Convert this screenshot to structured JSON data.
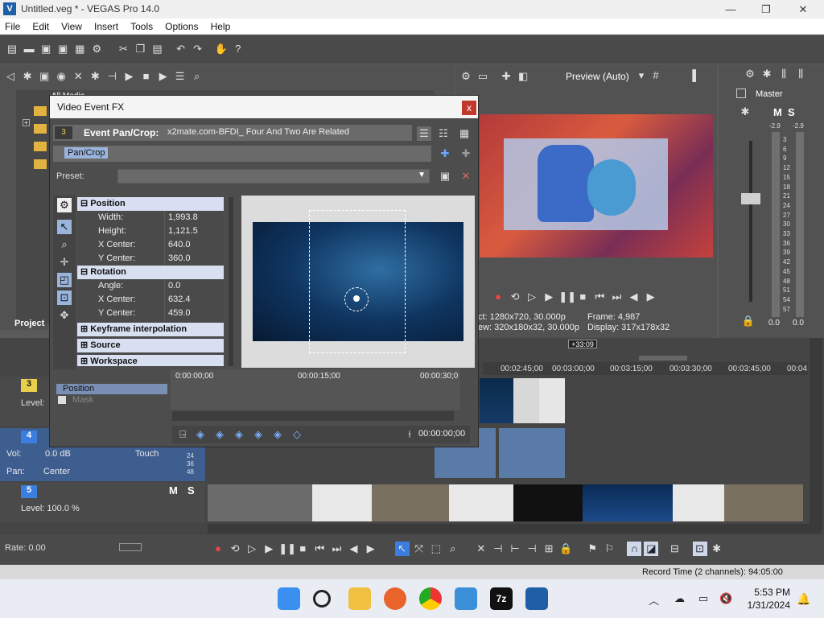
{
  "window": {
    "title": "Untitled.veg * - VEGAS Pro 14.0",
    "logo": "V",
    "minimize": "—",
    "maximize": "❐",
    "close": "✕"
  },
  "menu": [
    "File",
    "Edit",
    "View",
    "Insert",
    "Tools",
    "Options",
    "Help"
  ],
  "explorer": {
    "all_media": "All Media",
    "project_tab": "Project"
  },
  "dialog": {
    "title": "Video Event FX",
    "close": "x",
    "header_label": "Event Pan/Crop:",
    "header_value": "x2mate.com-BFDI_ Four And Two Are Related",
    "track_num": "3",
    "chain_item": "Pan/Crop",
    "preset_label": "Preset:",
    "sections": {
      "position": "Position",
      "rotation": "Rotation",
      "keyframe": "Keyframe interpolation",
      "source": "Source",
      "workspace": "Workspace"
    },
    "position": [
      {
        "k": "Width:",
        "v": "1,993.8"
      },
      {
        "k": "Height:",
        "v": "1,121.5"
      },
      {
        "k": "X Center:",
        "v": "640.0"
      },
      {
        "k": "Y Center:",
        "v": "360.0"
      }
    ],
    "rotation": [
      {
        "k": "Angle:",
        "v": "0.0"
      },
      {
        "k": "X Center:",
        "v": "632.4"
      },
      {
        "k": "Y Center:",
        "v": "459.0"
      }
    ],
    "kf_rows": {
      "position": "Position",
      "mask": "Mask"
    },
    "kf_ruler": [
      "0:00:00;00",
      "00:00:15;00",
      "00:00:30;0"
    ],
    "kf_time": "00:00:00;00"
  },
  "preview": {
    "label": "Preview (Auto)",
    "project_line": "ct:  1280x720, 30.000p",
    "preview_line": "ew:  320x180x32, 30.000p",
    "frame_line": "Frame:  4,987",
    "display_line": "Display:  317x178x32"
  },
  "master": {
    "label": "Master",
    "m": "M",
    "s": "S",
    "peak_l": "-2.9",
    "peak_r": "-2.9",
    "scale": [
      "3",
      "6",
      "9",
      "12",
      "15",
      "18",
      "21",
      "24",
      "27",
      "30",
      "33",
      "36",
      "39",
      "42",
      "45",
      "48",
      "51",
      "54",
      "57"
    ],
    "bottom_l": "0.0",
    "bottom_r": "0.0"
  },
  "timeline": {
    "ruler": [
      "00:02:45;00",
      "00:03:00;00",
      "00:03:15;00",
      "00:03:30;00",
      "00:03:45;00",
      "00:04"
    ],
    "marker": "+33:09",
    "tracks": [
      {
        "num": "3",
        "level_label": "Level:"
      },
      {
        "num": "4",
        "vol_label": "Vol:",
        "vol_value": "0.0 dB",
        "touch": "Touch",
        "pan_label": "Pan:",
        "pan_value": "Center",
        "meter": [
          "24",
          "36",
          "48"
        ]
      },
      {
        "num": "5",
        "level": "Level: 100.0 %",
        "m": "M",
        "s": "S"
      }
    ],
    "rate": "Rate: 0.00"
  },
  "status": {
    "record_time": "Record Time (2 channels): 94:05:00"
  },
  "taskbar": {
    "time": "5:53 PM",
    "date": "1/31/2024"
  },
  "colors": {
    "accent": "#3c7ee0",
    "panel": "#4a4a4a",
    "header": "#d7dff1"
  }
}
